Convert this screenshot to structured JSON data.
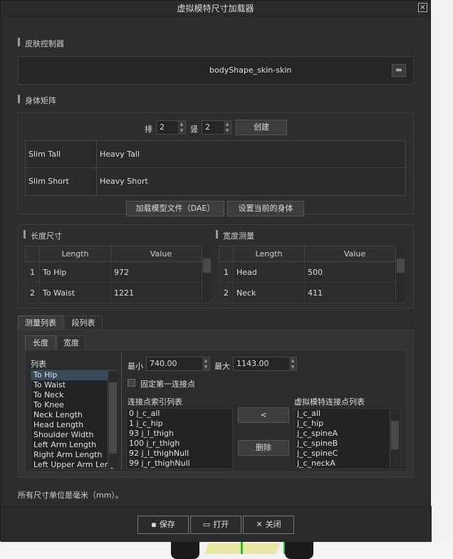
{
  "window": {
    "title": "虚拟模特尺寸加载器",
    "close_glyph": "×"
  },
  "skin": {
    "section": "皮肤控制器",
    "value": "bodyShape_skin-skin"
  },
  "matrix": {
    "section": "身体矩阵",
    "rows_label": "排",
    "rows_value": "2",
    "cols_label": "竖",
    "cols_value": "2",
    "create_label": "创建",
    "cells": [
      [
        "Slim Tall",
        "Heavy Tall"
      ],
      [
        "Slim Short",
        "Heavy Short"
      ]
    ],
    "load_dae_label": "加载模型文件（DAE）",
    "set_current_label": "设置当前的身体"
  },
  "length": {
    "section": "长度尺寸",
    "headers": [
      "Length",
      "Value"
    ],
    "rows": [
      [
        "1",
        "To Hip",
        "972"
      ],
      [
        "2",
        "To Waist",
        "1221"
      ]
    ]
  },
  "width": {
    "section": "宽度测量",
    "headers": [
      "Length",
      "Value"
    ],
    "rows": [
      [
        "1",
        "Head",
        "500"
      ],
      [
        "2",
        "Neck",
        "411"
      ]
    ]
  },
  "tabs": {
    "outer": [
      "测量列表",
      "段列表"
    ],
    "inner": [
      "长度",
      "宽度"
    ]
  },
  "list": {
    "label": "列表",
    "items": [
      "To Hip",
      "To Waist",
      "To Neck",
      "To Knee",
      "Neck Length",
      "Head Length",
      "Shoulder Width",
      "Left Arm Length",
      "Right Arm Length",
      "Left Upper Arm Leng"
    ]
  },
  "range": {
    "min_label": "最小",
    "min_value": "740.00",
    "max_label": "最大",
    "max_value": "1143.00",
    "fix_first_label": "固定第一连接点"
  },
  "joints": {
    "index_label": "连接点索引列表",
    "index_items": [
      "0 j_c_all",
      "1 j_c_hip",
      "93 j_l_thigh",
      "100 j_r_thigh",
      "92 j_l_thighNull",
      "99 j_r_thighNull"
    ],
    "add_label": "<",
    "delete_label": "删除",
    "model_label": "虚拟模特连接点列表",
    "model_items": [
      "j_c_all",
      "j_c_hip",
      "j_c_spineA",
      "j_c_spineB",
      "j_c_spineC",
      "j_c_neckA"
    ]
  },
  "footer": {
    "units_note": "所有尺寸单位是毫米（mm）。"
  },
  "buttons": {
    "save": "保存",
    "open": "打开",
    "close": "关闭"
  }
}
